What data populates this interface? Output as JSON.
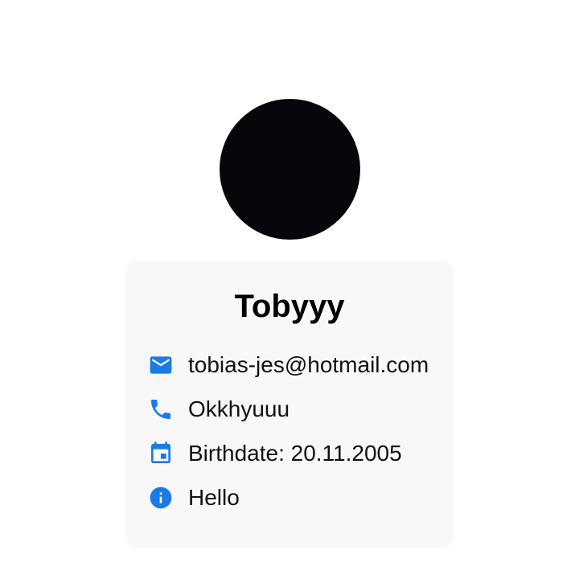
{
  "theme": {
    "accent": "#1a7ae8",
    "card_bg": "#f8f8f8",
    "avatar_color": "#07060b"
  },
  "profile": {
    "name": "Tobyyy",
    "details": [
      {
        "icon": "email-icon",
        "text": "tobias-jes@hotmail.com"
      },
      {
        "icon": "phone-icon",
        "text": "Okkhyuuu"
      },
      {
        "icon": "calendar-icon",
        "text": "Birthdate: 20.11.2005"
      },
      {
        "icon": "info-icon",
        "text": "Hello"
      }
    ]
  }
}
